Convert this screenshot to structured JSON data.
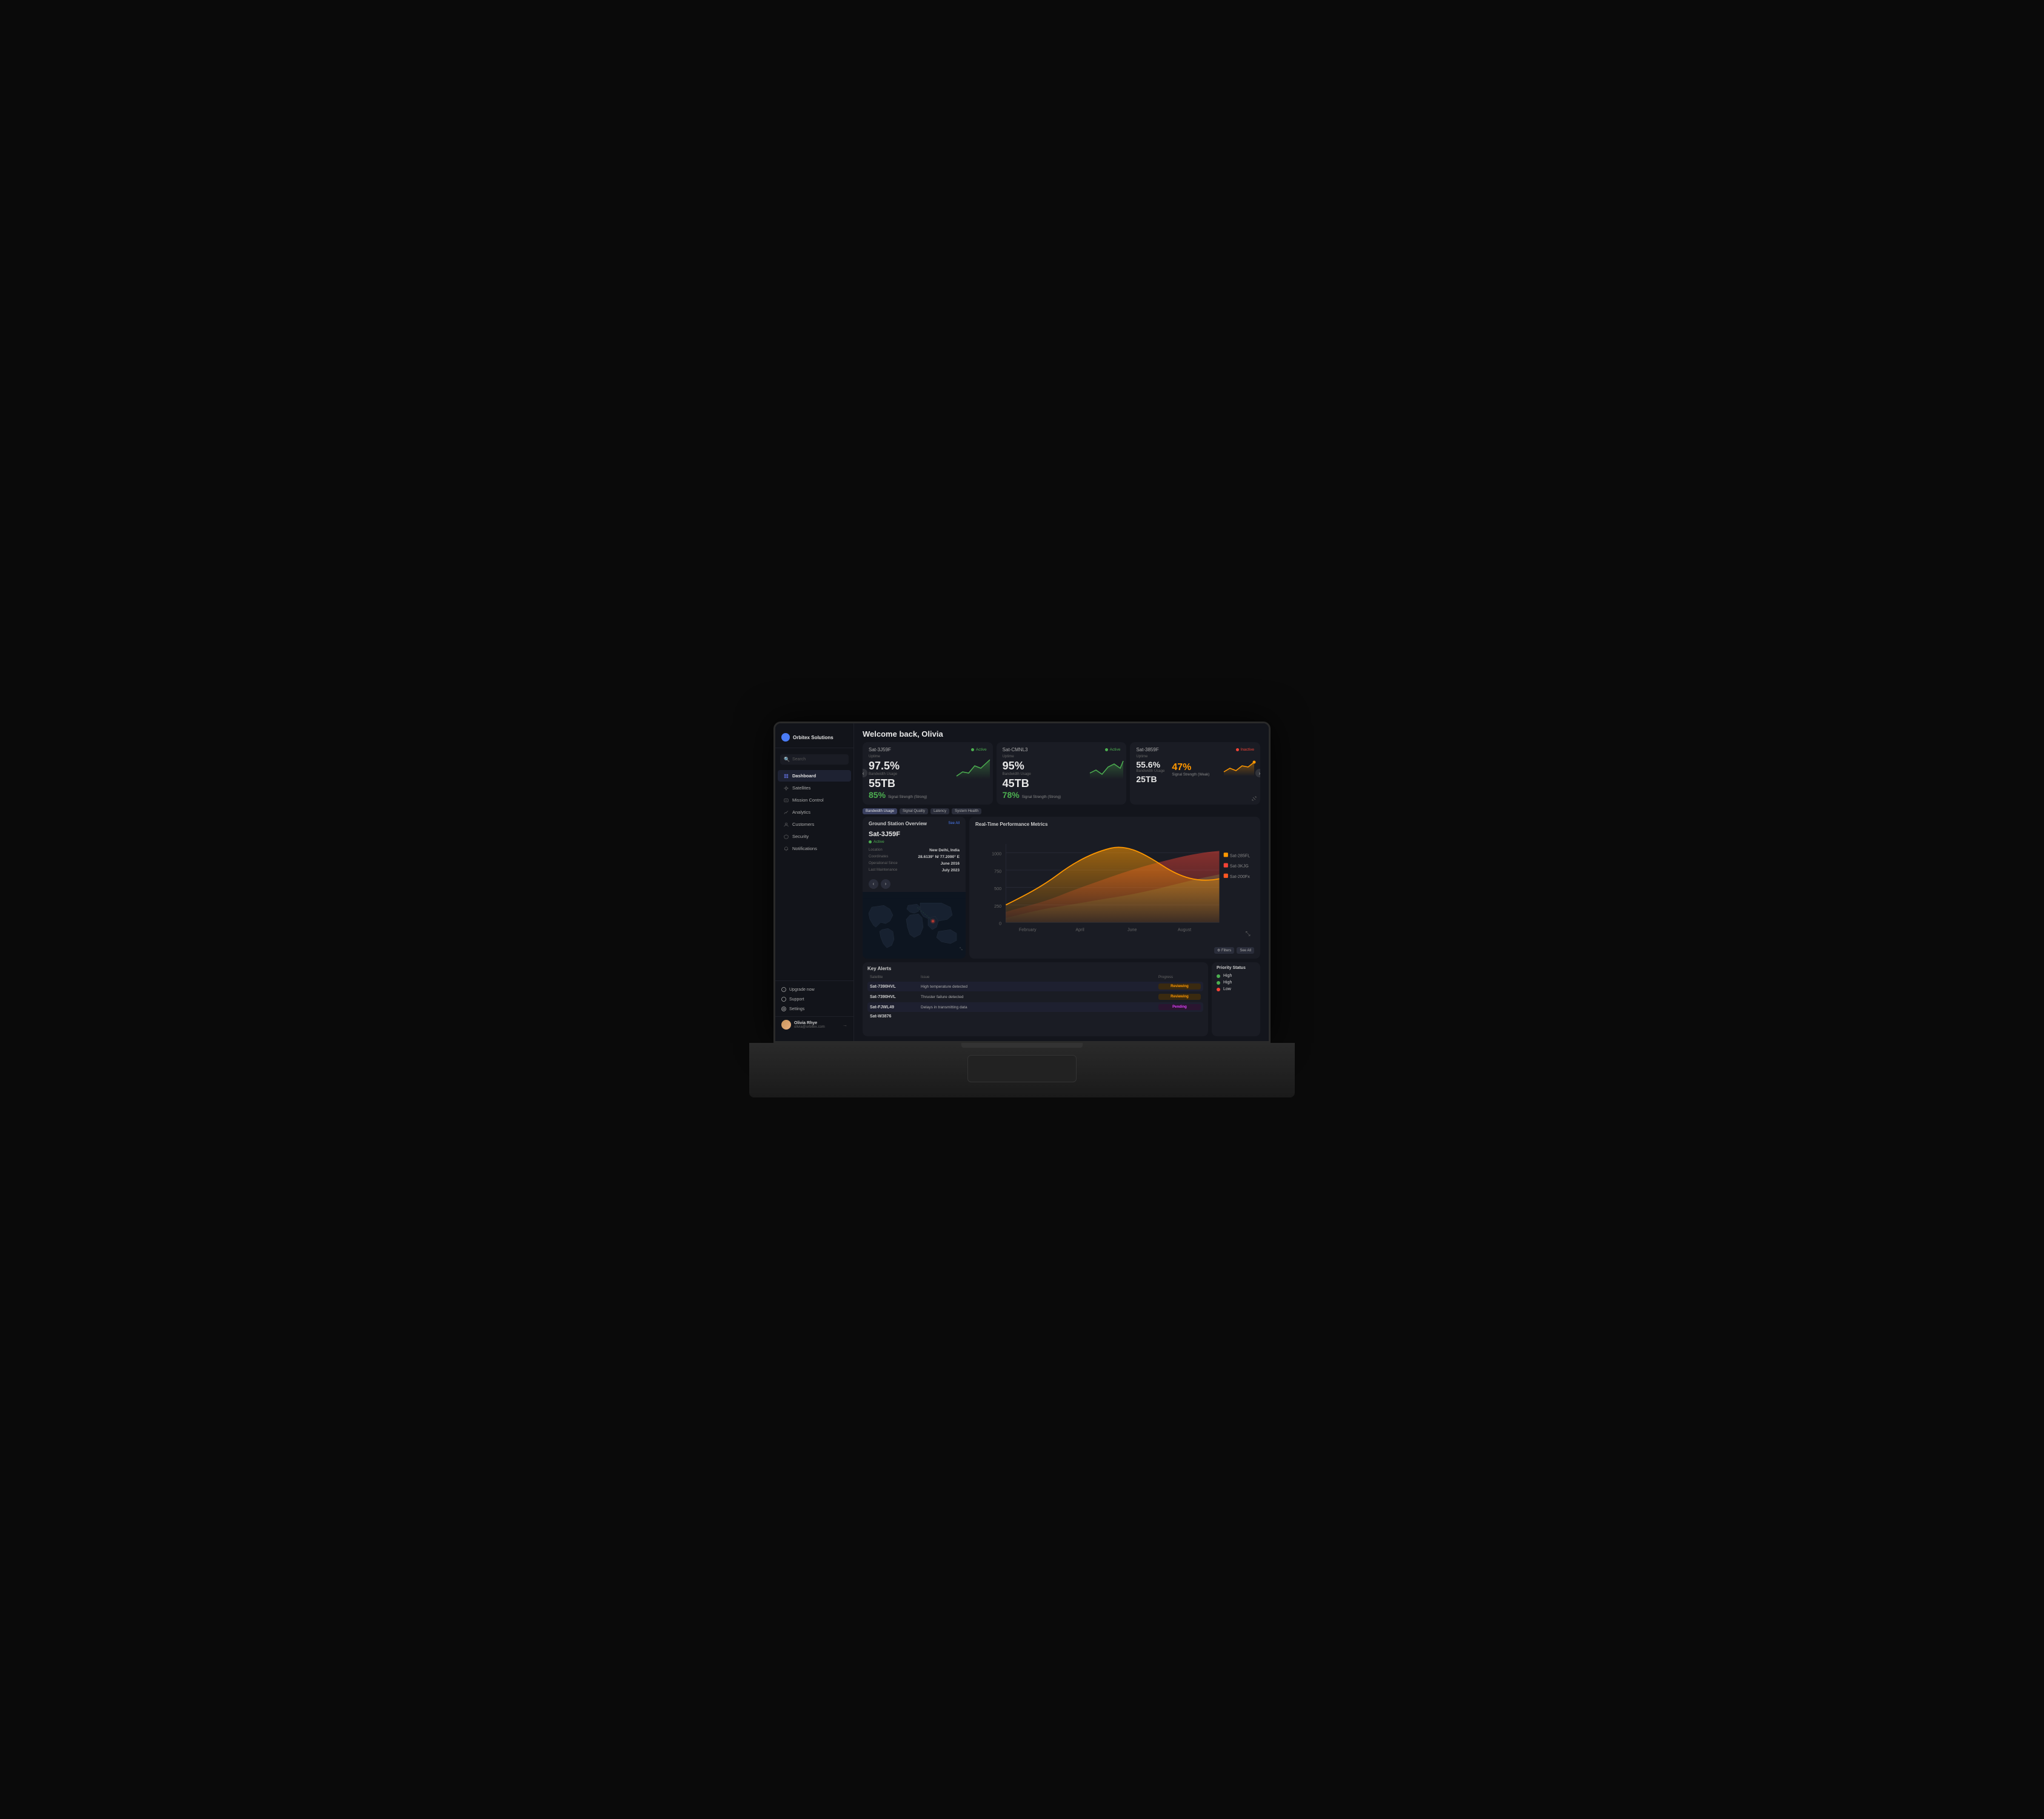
{
  "app": {
    "name": "Orbitex Solutions"
  },
  "sidebar": {
    "search_placeholder": "Search",
    "nav_items": [
      {
        "id": "dashboard",
        "label": "Dashboard",
        "active": true
      },
      {
        "id": "satellites",
        "label": "Satellites",
        "active": false
      },
      {
        "id": "mission-control",
        "label": "Mission Control",
        "active": false
      },
      {
        "id": "analytics",
        "label": "Analytics",
        "active": false
      },
      {
        "id": "customers",
        "label": "Customers",
        "active": false
      },
      {
        "id": "security",
        "label": "Security",
        "active": false
      },
      {
        "id": "notifications",
        "label": "Notifications",
        "active": false
      }
    ],
    "upgrade_label": "Upgrade now",
    "support_label": "Support",
    "settings_label": "Settings",
    "user": {
      "name": "Olivia Rhye",
      "email": "olivia@orbitex.com",
      "logout_label": "→"
    }
  },
  "header": {
    "welcome": "Welcome back, Olivia"
  },
  "satellites": {
    "cards": [
      {
        "id": "sat-3j59f",
        "name": "Sat-3J59F",
        "status": "Active",
        "uptime": "97.5%",
        "uptime_label": "Uptime",
        "bandwidth": "55TB",
        "bandwidth_label": "Bandwidth Usage",
        "signal": "85%",
        "signal_label": "Signal Strength (Strong)",
        "signal_color": "green"
      },
      {
        "id": "sat-cmnl3",
        "name": "Sat-CMNL3",
        "status": "Active",
        "uptime": "95%",
        "uptime_label": "Uptime",
        "bandwidth": "45TB",
        "bandwidth_label": "Bandwidth Usage",
        "signal": "78%",
        "signal_label": "Signal Strength (Strong)",
        "signal_color": "green"
      },
      {
        "id": "sat-3859f",
        "name": "Sat-3859F",
        "status": "Inactive",
        "uptime": "55.6%",
        "uptime_label": "Uptime",
        "bandwidth": "25TB",
        "bandwidth_label": "Bandwidth Usage",
        "signal": "47%",
        "signal_label": "Signal Strength (Weak)",
        "signal_color": "orange"
      }
    ]
  },
  "performance_tabs": [
    "Bandwidth Usage",
    "Signal Quality",
    "Latency",
    "System Health"
  ],
  "performance_chart": {
    "title": "Real-Time Performance Metrics",
    "y_labels": [
      "1000",
      "750",
      "500",
      "250",
      "0"
    ],
    "x_labels": [
      "February",
      "April",
      "June",
      "August"
    ],
    "legend": [
      {
        "name": "Sat-285FL",
        "color": "#ff9800"
      },
      {
        "name": "Sat-3KJG",
        "color": "#f44336"
      },
      {
        "name": "Sat-200Fx",
        "color": "#ff5722"
      }
    ]
  },
  "ground_station": {
    "title": "Ground Station Overview",
    "see_all": "See All",
    "sat_name": "Sat-3J59F",
    "status": "Active",
    "location_label": "Location",
    "location_value": "New Delhi, India",
    "coordinates_label": "Coordinates",
    "coordinates_value": "28.6139° N/ 77.2090° E",
    "since_label": "Operational Since",
    "since_value": "June 2016",
    "maintenance_label": "Last Maintenance",
    "maintenance_value": "July 2023"
  },
  "alerts": {
    "title": "Key Alerts",
    "col_satellite": "Satellite",
    "col_issue": "Issue",
    "col_progress": "Progress",
    "rows": [
      {
        "satellite": "Sat-7390HVL",
        "issue": "High temperature detected",
        "progress": "Reviewing",
        "badge_class": "badge-reviewing"
      },
      {
        "satellite": "Sat-7390HVL",
        "issue": "Thruster failure detected",
        "progress": "Reviewing",
        "badge_class": "badge-reviewing"
      },
      {
        "satellite": "Sat-FJWL49",
        "issue": "Delays in transmitting data",
        "progress": "Pending",
        "badge_class": "badge-pending"
      },
      {
        "satellite": "Sat-W3876",
        "issue": "",
        "progress": "",
        "badge_class": ""
      }
    ]
  },
  "priority_status": {
    "title": "Priority Status",
    "items": [
      {
        "label": "High",
        "color": "#4caf50"
      },
      {
        "label": "High",
        "color": "#4caf50"
      },
      {
        "label": "Low",
        "color": "#f44336"
      }
    ]
  }
}
